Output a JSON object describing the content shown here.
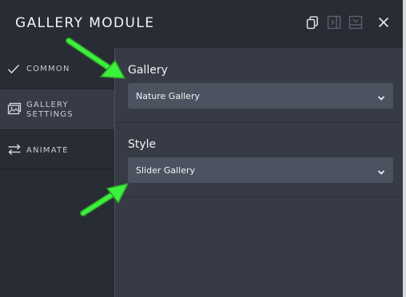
{
  "header": {
    "title": "GALLERY MODULE",
    "icons": [
      "copy-icon",
      "panel-right-icon",
      "save-icon",
      "close-icon"
    ]
  },
  "sidebar": {
    "items": [
      {
        "label": "COMMON",
        "icon": "checkmark-icon",
        "active": false
      },
      {
        "label_line1": "GALLERY",
        "label_line2": "SETTINGS",
        "icon": "image-icon",
        "active": true
      },
      {
        "label": "ANIMATE",
        "icon": "swap-arrows-icon",
        "active": false
      }
    ]
  },
  "main": {
    "gallery": {
      "label": "Gallery",
      "value": "Nature Gallery"
    },
    "style": {
      "label": "Style",
      "value": "Slider Gallery"
    }
  },
  "colors": {
    "header_bg": "#282c34",
    "panel_bg": "#363b45",
    "select_bg": "#4c5360",
    "annotation_arrow": "#3df03b"
  }
}
